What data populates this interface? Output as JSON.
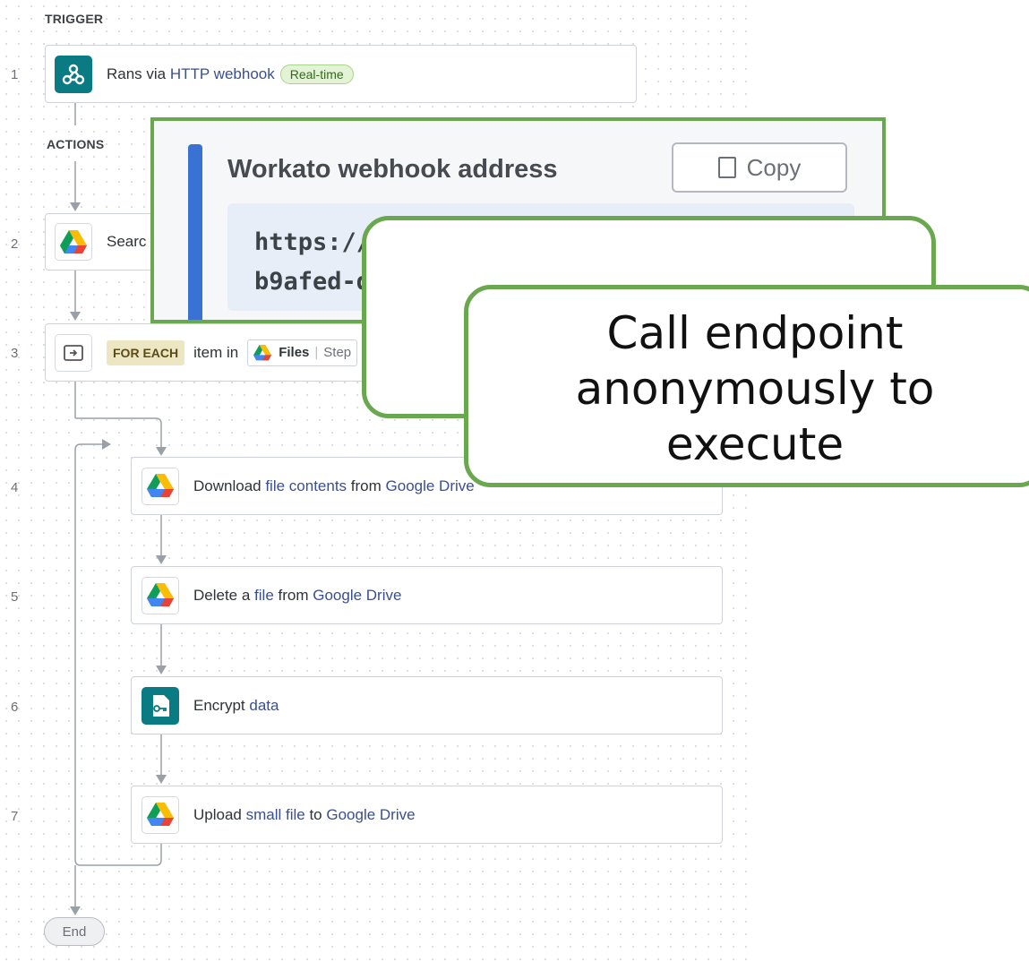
{
  "sections": {
    "trigger": "TRIGGER",
    "actions": "ACTIONS"
  },
  "steps": [
    {
      "number": "1",
      "parts": [
        "Rans via ",
        "HTTP webhook"
      ],
      "badge": "Real-time",
      "icon": "webhook-icon"
    },
    {
      "number": "2",
      "text": "Searc",
      "icon": "google-drive-icon"
    },
    {
      "number": "3",
      "label": "FOR EACH",
      "text": "item in",
      "chip_label": "Files",
      "chip_step": "Step",
      "icon": "loop-icon"
    },
    {
      "number": "4",
      "parts": [
        "Download ",
        "file contents",
        " from ",
        "Google Drive"
      ],
      "icon": "google-drive-icon"
    },
    {
      "number": "5",
      "parts": [
        "Delete a ",
        "file",
        " from ",
        "Google Drive"
      ],
      "icon": "google-drive-icon"
    },
    {
      "number": "6",
      "parts": [
        "Encrypt ",
        "data"
      ],
      "icon": "encrypt-file-icon"
    },
    {
      "number": "7",
      "parts": [
        "Upload ",
        "small file",
        " to ",
        "Google Drive"
      ],
      "icon": "google-drive-icon"
    }
  ],
  "end_label": "End",
  "popup": {
    "title": "Workato webhook address",
    "copy_label": "Copy",
    "url_line1": "https://w",
    "url_line2": "b9afed-d"
  },
  "callout": {
    "line1": "Call endpoint",
    "line2": "anonymously to",
    "line3": "execute"
  },
  "colors": {
    "accent_green": "#6aa84f",
    "link": "#3a4f8f",
    "blue_bar": "#3a72d4"
  }
}
